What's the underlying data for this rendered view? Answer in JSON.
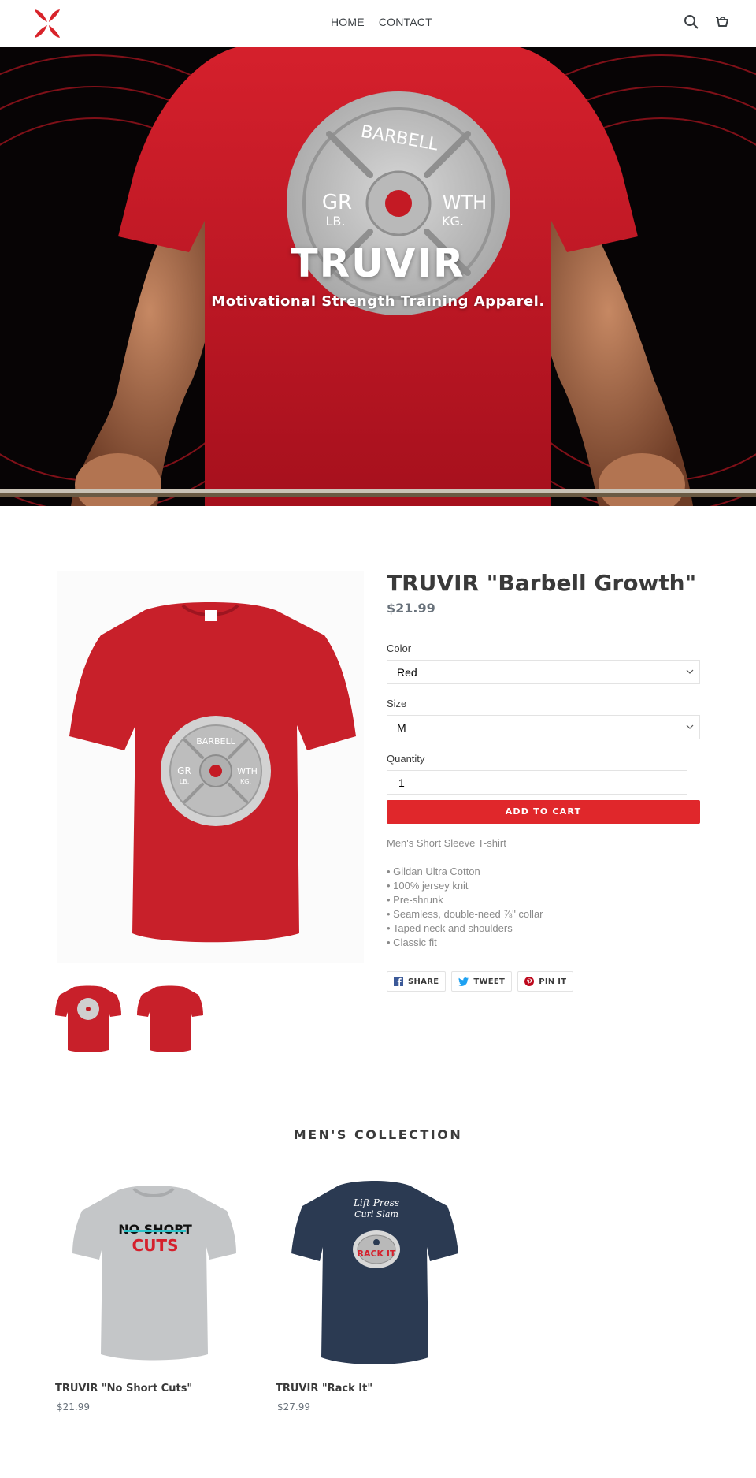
{
  "header": {
    "logo_icon": "truvir-x-logo",
    "nav": [
      {
        "label": "HOME"
      },
      {
        "label": "CONTACT"
      }
    ],
    "icons": [
      "search-icon",
      "cart-icon"
    ]
  },
  "hero": {
    "title": "TRUVIR",
    "subtitle": "Motivational Strength Training Apparel.",
    "plate_text": {
      "top": "BARBELL",
      "left_big": "GR",
      "left_small": "LB.",
      "right_big": "WTH",
      "right_small": "KG."
    }
  },
  "product": {
    "title": "TRUVIR \"Barbell Growth\"",
    "price": "$21.99",
    "color_label": "Color",
    "color_value": "Red",
    "size_label": "Size",
    "size_value": "M",
    "quantity_label": "Quantity",
    "quantity_value": "1",
    "add_to_cart": "ADD TO CART",
    "description": "Men's Short Sleeve T-shirt",
    "bullets": [
      "• Gildan Ultra Cotton",
      "• 100% jersey knit",
      "• Pre-shrunk",
      "• Seamless, double-need ⅞\" collar",
      "• Taped neck and shoulders",
      "• Classic fit"
    ],
    "share": [
      {
        "label": "SHARE",
        "icon": "facebook-icon"
      },
      {
        "label": "TWEET",
        "icon": "twitter-icon"
      },
      {
        "label": "PIN IT",
        "icon": "pinterest-icon"
      }
    ],
    "main_image_plate": {
      "top": "BARBELL",
      "left_big": "GR",
      "left_small": "LB.",
      "right_big": "WTH",
      "right_small": "KG."
    }
  },
  "collection": {
    "title": "MEN'S COLLECTION",
    "items": [
      {
        "name": "TRUVIR \"No Short Cuts\"",
        "price": "$21.99",
        "print_line1": "NO SHORT",
        "print_line2": "CUTS"
      },
      {
        "name": "TRUVIR \"Rack It\"",
        "price": "$27.99",
        "print_line1": "Lift Press",
        "print_line2": "Curl Slam",
        "print_line3": "RACK IT"
      }
    ]
  },
  "colors": {
    "accent": "#e0272b",
    "shirt_red": "#c8202a",
    "shirt_grey": "#c4c6c8",
    "shirt_navy": "#2b3a52",
    "text_dark": "#3a3a3a",
    "text_muted": "#8a8a8a"
  }
}
